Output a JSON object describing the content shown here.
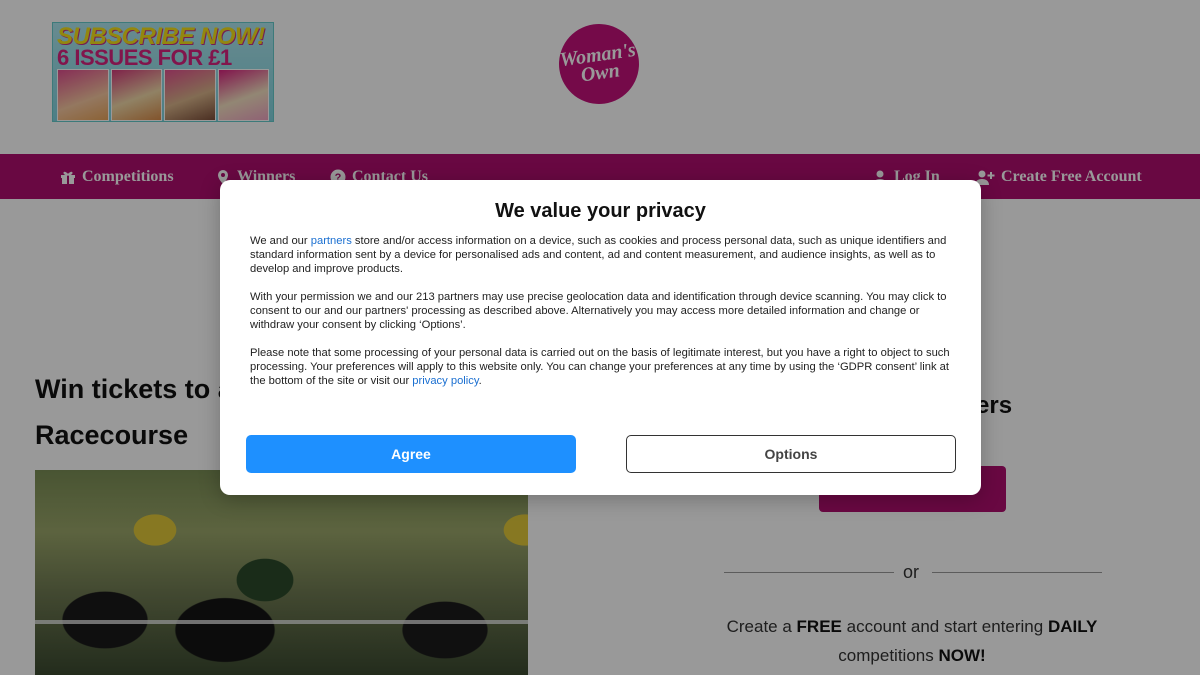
{
  "header": {
    "subscribe_line1": "SUBSCRIBE NOW!",
    "subscribe_line2": "6 ISSUES FOR £1",
    "logo_line1": "Woman's",
    "logo_line2": "Own"
  },
  "nav": {
    "competitions": "Competitions",
    "winners": "Winners",
    "contact": "Contact Us",
    "login": "Log In",
    "create_account": "Create Free Account"
  },
  "main": {
    "title_line1": "Win tickets to a",
    "title_line2": "Racecourse",
    "right_heading": "ers",
    "or": "or",
    "cta_create": "Create a",
    "cta_free": "FREE",
    "cta_middle": "account and start entering",
    "cta_daily": "DAILY",
    "cta_competitions": "competitions",
    "cta_now": "NOW!"
  },
  "privacy_modal": {
    "title": "We value your privacy",
    "p1_before_link": "We and our ",
    "p1_link": "partners",
    "p1_after_link": " store and/or access information on a device, such as cookies and process personal data, such as unique identifiers and standard information sent by a device for personalised ads and content, ad and content measurement, and audience insights, as well as to develop and improve products.",
    "p2": "With your permission we and our 213 partners may use precise geolocation data and identification through device scanning. You may click to consent to our and our partners' processing as described above. Alternatively you may access more detailed information and change or withdraw your consent by clicking ‘Options’.",
    "p3_before_link": "Please note that some processing of your personal data is carried out on the basis of legitimate interest, but you have a right to object to such processing. Your preferences will apply to this website only. You can change your preferences at any time by using the ‘GDPR consent’ link at the bottom of the site or visit our ",
    "p3_link": "privacy policy",
    "p3_after_link": ".",
    "agree_label": "Agree",
    "options_label": "Options"
  },
  "colors": {
    "brand_magenta": "#b00e6f",
    "agree_blue": "#1e90ff",
    "link_blue": "#1a6fd1"
  }
}
